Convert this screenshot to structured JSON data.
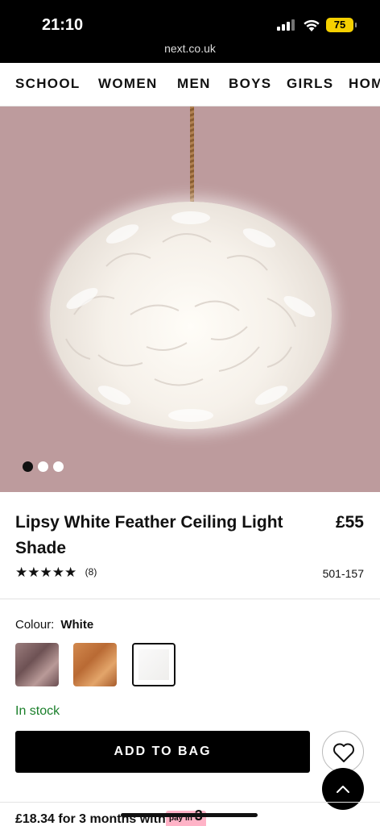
{
  "status_bar": {
    "time": "21:10",
    "url": "next.co.uk",
    "battery": "75"
  },
  "nav": {
    "items": [
      "SCHOOL",
      "WOMEN",
      "MEN",
      "BOYS",
      "GIRLS",
      "HOME"
    ]
  },
  "gallery": {
    "active_index": 0,
    "count": 3
  },
  "product": {
    "title": "Lipsy White Feather Ceiling Light Shade",
    "price": "£55",
    "rating": 4.5,
    "stars_display": "★★★★★",
    "review_count": "(8)",
    "code": "501-157"
  },
  "colour": {
    "label": "Colour:",
    "selected": "White",
    "options": [
      "Grey",
      "Copper",
      "White"
    ]
  },
  "stock_status": "In stock",
  "actions": {
    "add_to_bag": "ADD TO BAG"
  },
  "finance": {
    "text": "£18.34 for 3 months with",
    "badge_top": "pay in",
    "badge_num": "3"
  },
  "colors": {
    "stock_green": "#1a7f2a",
    "battery": "#f5d000",
    "klarna_pink": "#ffb3c7"
  }
}
